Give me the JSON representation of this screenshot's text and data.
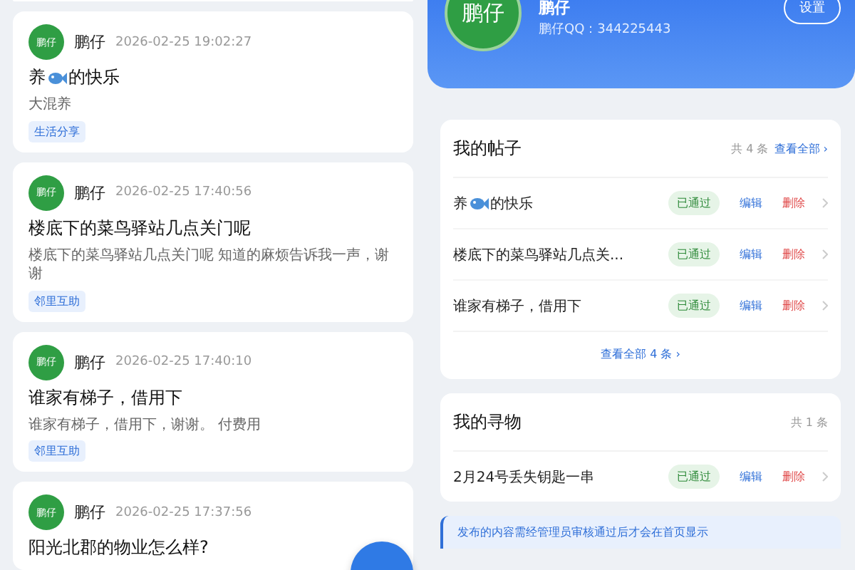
{
  "feed": [
    {
      "author": "鹏仔",
      "avatar": "鹏仔",
      "time": "2026-02-25 19:02:27",
      "title": [
        {
          "kind": "text",
          "text": "养"
        },
        {
          "kind": "fish"
        },
        {
          "kind": "text",
          "text": "的快乐"
        }
      ],
      "body": "大混养",
      "tag": "生活分享"
    },
    {
      "author": "鹏仔",
      "avatar": "鹏仔",
      "time": "2026-02-25 17:40:56",
      "title": [
        {
          "kind": "text",
          "text": "楼底下的菜鸟驿站几点关门呢"
        }
      ],
      "body": "楼底下的菜鸟驿站几点关门呢 知道的麻烦告诉我一声，谢谢",
      "tag": "邻里互助"
    },
    {
      "author": "鹏仔",
      "avatar": "鹏仔",
      "time": "2026-02-25 17:40:10",
      "title": [
        {
          "kind": "text",
          "text": "谁家有梯子，借用下"
        }
      ],
      "body": "谁家有梯子，借用下，谢谢。 付费用",
      "tag": "邻里互助"
    },
    {
      "author": "鹏仔",
      "avatar": "鹏仔",
      "time": "2026-02-25 17:37:56",
      "title": [
        {
          "kind": "text",
          "text": "阳光北郡的物业怎么样?"
        }
      ]
    }
  ],
  "profile": {
    "avatar": "鹏仔",
    "name": "鹏仔",
    "qq": "鹏仔QQ：344225443",
    "settings": "设置"
  },
  "my_posts": {
    "title": "我的帖子",
    "count": "共 4 条",
    "view_all": "查看全部 ›",
    "rows": [
      {
        "title": [
          {
            "kind": "text",
            "text": "养"
          },
          {
            "kind": "fish"
          },
          {
            "kind": "text",
            "text": "的快乐"
          }
        ],
        "status": "已通过",
        "edit": "编辑",
        "delete": "删除"
      },
      {
        "title": [
          {
            "kind": "text",
            "text": "楼底下的菜鸟驿站几点关..."
          }
        ],
        "status": "已通过",
        "edit": "编辑",
        "delete": "删除"
      },
      {
        "title": [
          {
            "kind": "text",
            "text": "谁家有梯子，借用下"
          }
        ],
        "status": "已通过",
        "edit": "编辑",
        "delete": "删除"
      }
    ],
    "footer": "查看全部 4 条 ›"
  },
  "my_lost": {
    "title": "我的寻物",
    "count": "共 1 条",
    "rows": [
      {
        "title": [
          {
            "kind": "text",
            "text": "2月24号丢失钥匙一串"
          }
        ],
        "status": "已通过",
        "edit": "编辑",
        "delete": "删除"
      }
    ]
  },
  "notice": "发布的内容需经管理员审核通过后才会在首页显示"
}
